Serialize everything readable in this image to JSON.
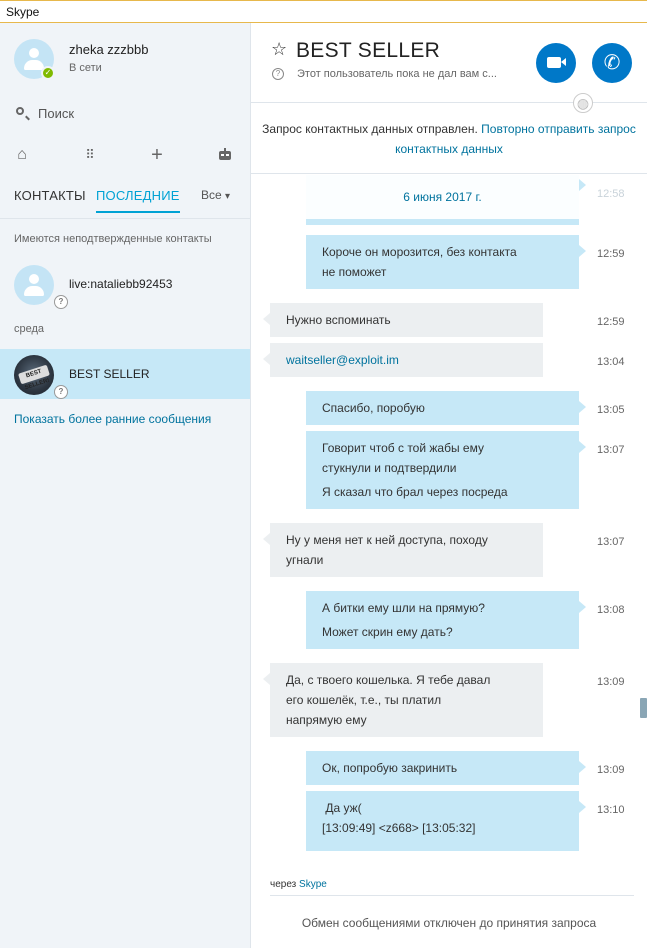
{
  "window": {
    "title": "Skype"
  },
  "profile": {
    "name": "zheka zzzbbb",
    "status": "В сети"
  },
  "search": {
    "label": "Поиск"
  },
  "toolbar": {
    "icons": [
      "home-icon",
      "dialpad-icon",
      "add-icon",
      "bot-icon"
    ]
  },
  "tabs": {
    "contacts": "КОНТАКТЫ",
    "recent": "ПОСЛЕДНИЕ",
    "filter": "Все"
  },
  "sidebar": {
    "unconfirmed_note": "Имеются неподтвержденные контакты",
    "contact1": {
      "name": "live:nataliebb92453"
    },
    "day_label": "среда",
    "contact2": {
      "name": "BEST SELLER",
      "logo_text": "BEST SELLER!"
    },
    "older_link": "Показать более ранние сообщения"
  },
  "conversation": {
    "title": "BEST SELLER",
    "subtitle": "Этот пользователь пока не дал вам с...",
    "notice_text": "Запрос контактных данных отправлен.",
    "notice_link": "Повторно отправить запрос контактных данных",
    "date": "6 июня 2017 г.",
    "ghost_time": "12:58",
    "messages": [
      {
        "dir": "out",
        "lines": [
          "Короче он морозится, без контакта",
          "не поможет"
        ],
        "time": "12:59"
      },
      {
        "dir": "in",
        "lines": [
          "Нужно вспоминать"
        ],
        "time": "12:59"
      },
      {
        "dir": "in",
        "lines": [
          "waitseller@exploit.im"
        ],
        "time": "13:04"
      },
      {
        "dir": "out",
        "lines": [
          "Спасибо, поробую"
        ],
        "time": "13:05"
      },
      {
        "dir": "out",
        "lines": [
          "Говорит чтоб с той жабы ему",
          "стукнули и подтвердили",
          "Я сказал что брал через посреда"
        ],
        "time": "13:07"
      },
      {
        "dir": "in",
        "lines": [
          "Ну у меня нет к ней доступа, походу",
          "угнали"
        ],
        "time": "13:07"
      },
      {
        "dir": "out",
        "lines": [
          "А битки ему шли на прямую?",
          "Может скрин ему дать?"
        ],
        "time": "13:08"
      },
      {
        "dir": "in",
        "lines": [
          "Да, с твоего кошелька. Я тебе давал",
          "его кошелёк, т.е., ты платил",
          "напрямую ему"
        ],
        "time": "13:09"
      },
      {
        "dir": "out",
        "lines": [
          "Ок, попробую закринить"
        ],
        "time": "13:09"
      },
      {
        "dir": "out",
        "lines": [
          " Да уж(",
          "[13:09:49] <z668> [13:05:32]"
        ],
        "time": "13:10"
      }
    ],
    "via_prefix": "через",
    "via_service": "Skype",
    "footer": "Обмен сообщениями отключен до принятия запроса"
  },
  "colors": {
    "accent": "#00a2d4",
    "call_button": "#0078c8",
    "outgoing_bubble": "#c6e8f7",
    "incoming_bubble": "#eceff1",
    "online": "#7fba00"
  }
}
